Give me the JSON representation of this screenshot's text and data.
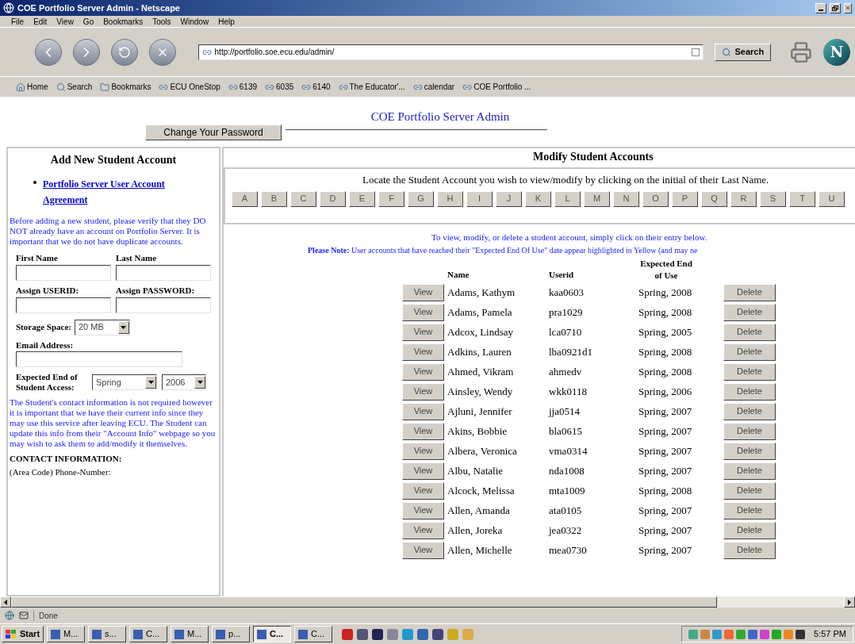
{
  "window": {
    "title": "COE Portfolio Server Admin - Netscape"
  },
  "menu": [
    "File",
    "Edit",
    "View",
    "Go",
    "Bookmarks",
    "Tools",
    "Window",
    "Help"
  ],
  "toolbar": {
    "address": "http://portfolio.soe.ecu.edu/admin/",
    "search_button": "Search",
    "logo": "N"
  },
  "bookmarks": [
    {
      "label": "Home",
      "kind": "home"
    },
    {
      "label": "Search",
      "kind": "search"
    },
    {
      "label": "Bookmarks",
      "kind": "folder"
    },
    {
      "label": "ECU OneStop",
      "kind": "link"
    },
    {
      "label": "6139",
      "kind": "link"
    },
    {
      "label": "6035",
      "kind": "link"
    },
    {
      "label": "6140",
      "kind": "link"
    },
    {
      "label": "The Educator'...",
      "kind": "link"
    },
    {
      "label": "calendar",
      "kind": "link"
    },
    {
      "label": "COE Portfolio ...",
      "kind": "link"
    }
  ],
  "page": {
    "title": "COE Portfolio Server Admin",
    "change_password_button": "Change Your Password"
  },
  "add_panel": {
    "heading": "Add New Student Account",
    "agreement_link": "Portfolio Server User Account Agreement",
    "notice": "Before adding a new student, please verify that they DO NOT already have an account on Portfolio Server. It is important that we do not have duplicate accounts.",
    "name_fields": [
      {
        "label": "First Name"
      },
      {
        "label": "Last Name"
      }
    ],
    "account_fields": [
      {
        "label": "Assign USERID:"
      },
      {
        "label": "Assign PASSWORD:"
      }
    ],
    "storage": {
      "label": "Storage Space:",
      "value": "20 MB"
    },
    "email": {
      "label": "Email Address:"
    },
    "end_of_access": {
      "label": "Expected End of Student Access:",
      "term": "Spring",
      "year": "2006"
    },
    "contact_notice": "The Student's contact information is not required however it is important that we have their current info since they may use this service after leaving ECU. The Student can update this info from their \"Account Info\" webpage so you may wish to ask them to add/modify it themselves.",
    "contact_heading": "CONTACT INFORMATION:",
    "phone_label": "(Area Code) Phone-Number:"
  },
  "modify_panel": {
    "heading": "Modify Student Accounts",
    "instructions": "Locate the Student Account you wish to view/modify by clicking on the initial of their Last Name.",
    "letters": [
      "A",
      "B",
      "C",
      "D",
      "E",
      "F",
      "G",
      "H",
      "I",
      "J",
      "K",
      "L",
      "M",
      "N",
      "O",
      "P",
      "Q",
      "R",
      "S",
      "T",
      "U"
    ],
    "note": "To view, modify, or delete a student account, simply click on their entry below.",
    "note_highlight": "**Please Note:** User accounts that have reached their \"Expected End Of Use\" date appear highlighted in Yellow (and may ne",
    "columns": [
      "Name",
      "Userid",
      "Expected End of Use"
    ],
    "rows": [
      {
        "view_button": "View",
        "name": "Adams, Kathym",
        "userid": "kaa0603",
        "end_of_use": "Spring, 2008",
        "delete_button": "Delete"
      },
      {
        "view_button": "View",
        "name": "Adams, Pamela",
        "userid": "pra1029",
        "end_of_use": "Spring, 2008",
        "delete_button": "Delete"
      },
      {
        "view_button": "View",
        "name": "Adcox, Lindsay",
        "userid": "lca0710",
        "end_of_use": "Spring, 2005",
        "delete_button": "Delete"
      },
      {
        "view_button": "View",
        "name": "Adkins, Lauren",
        "userid": "lba0921d1",
        "end_of_use": "Spring, 2008",
        "delete_button": "Delete"
      },
      {
        "view_button": "View",
        "name": "Ahmed, Vikram",
        "userid": "ahmedv",
        "end_of_use": "Spring, 2008",
        "delete_button": "Delete"
      },
      {
        "view_button": "View",
        "name": "Ainsley, Wendy",
        "userid": "wkk0118",
        "end_of_use": "Spring, 2006",
        "delete_button": "Delete"
      },
      {
        "view_button": "View",
        "name": "Ajluni, Jennifer",
        "userid": "jja0514",
        "end_of_use": "Spring, 2007",
        "delete_button": "Delete"
      },
      {
        "view_button": "View",
        "name": "Akins, Bobbie",
        "userid": "bla0615",
        "end_of_use": "Spring, 2007",
        "delete_button": "Delete"
      },
      {
        "view_button": "View",
        "name": "Albera, Veronica",
        "userid": "vma0314",
        "end_of_use": "Spring, 2007",
        "delete_button": "Delete"
      },
      {
        "view_button": "View",
        "name": "Albu, Natalie",
        "userid": "nda1008",
        "end_of_use": "Spring, 2007",
        "delete_button": "Delete"
      },
      {
        "view_button": "View",
        "name": "Alcock, Melissa",
        "userid": "mta1009",
        "end_of_use": "Spring, 2008",
        "delete_button": "Delete"
      },
      {
        "view_button": "View",
        "name": "Allen, Amanda",
        "userid": "ata0105",
        "end_of_use": "Spring, 2007",
        "delete_button": "Delete"
      },
      {
        "view_button": "View",
        "name": "Allen, Joreka",
        "userid": "jea0322",
        "end_of_use": "Spring, 2007",
        "delete_button": "Delete"
      },
      {
        "view_button": "View",
        "name": "Allen, Michelle",
        "userid": "mea0730",
        "end_of_use": "Spring, 2007",
        "delete_button": "Delete"
      }
    ]
  },
  "status_bar": {
    "text": "Done"
  },
  "taskbar": {
    "start": "Start",
    "tasks": [
      {
        "label": "M...",
        "selected": false
      },
      {
        "label": "s...",
        "selected": false
      },
      {
        "label": "C...",
        "selected": false
      },
      {
        "label": "M...",
        "selected": false
      },
      {
        "label": "p...",
        "selected": false
      },
      {
        "label": "C...",
        "selected": true
      },
      {
        "label": "C...",
        "selected": false
      }
    ],
    "clock": "5:57 PM"
  }
}
